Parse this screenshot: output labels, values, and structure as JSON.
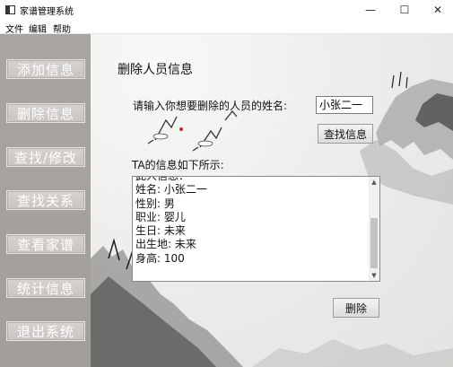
{
  "window": {
    "title": "家谱管理系统",
    "minimize_glyph": "—",
    "maximize_glyph": "☐",
    "close_glyph": "✕"
  },
  "menu": [
    "文件",
    "编辑",
    "帮助"
  ],
  "sidebar": {
    "items": [
      "添加信息",
      "删除信息",
      "查找/修改",
      "查找关系",
      "查看家谱",
      "统计信息",
      "退出系统"
    ]
  },
  "main": {
    "heading": "删除人员信息",
    "prompt": "请输入你想要删除的人员的姓名:",
    "name_value": "小张二一",
    "find_button": "查找信息",
    "info_label": "TA的信息如下所示:",
    "info_lines": [
      "此人信息：",
      "姓名:  小张二一",
      "性别:  男",
      "职业:  婴儿",
      "生日:  未来",
      "出生地:  未来",
      "身高:  100"
    ],
    "delete_button": "删除"
  },
  "icons": {
    "app": "app-window-icon",
    "scroll_up": "▲",
    "scroll_down": "▼"
  },
  "colors": {
    "sidebar": "#a6a2a0",
    "button_text": "#ffffff"
  }
}
